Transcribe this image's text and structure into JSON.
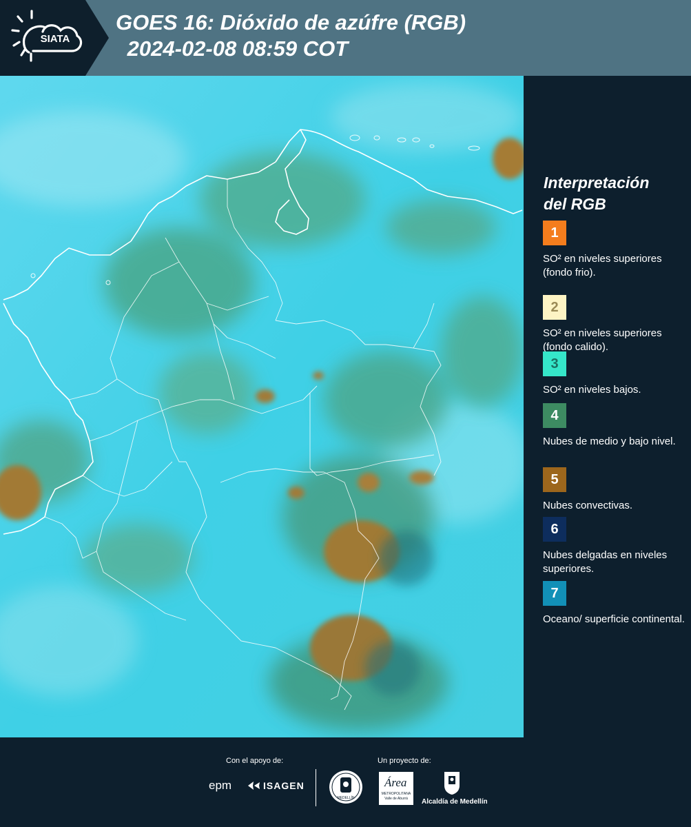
{
  "header": {
    "logo_text": "SIATA",
    "title_line1": "GOES 16: Dióxido de azúfre (RGB)",
    "title_line2": " 2024-02-08 08:59 COT"
  },
  "map": {
    "satellite": "GOES 16",
    "product": "Dióxido de azúfre (RGB)"
  },
  "legend": {
    "title_line1": "Interpretación",
    "title_line2": "del RGB",
    "items": [
      {
        "number": "1",
        "color": "#f47d1d",
        "text_color": "#ffffff",
        "label": "SO² en niveles superiores (fondo frio)."
      },
      {
        "number": "2",
        "color": "#fdf4c4",
        "text_color": "#9a8a55",
        "label": "SO² en niveles superiores (fondo calido)."
      },
      {
        "number": "3",
        "color": "#35e6c9",
        "text_color": "#1a6f62",
        "label": "SO² en niveles bajos."
      },
      {
        "number": "4",
        "color": "#3d8b62",
        "text_color": "#ffffff",
        "label": "Nubes de medio y bajo nivel."
      },
      {
        "number": "5",
        "color": "#9c661c",
        "text_color": "#ffffff",
        "label": "Nubes convectivas."
      },
      {
        "number": "6",
        "color": "#0d2d5d",
        "text_color": "#ffffff",
        "label": "Nubes delgadas en niveles superiores."
      },
      {
        "number": "7",
        "color": "#1290b7",
        "text_color": "#ffffff",
        "label": "Oceano/ superficie continental."
      }
    ]
  },
  "footer": {
    "support_caption": "Con el apoyo de:",
    "project_caption": "Un proyecto de:",
    "sponsors": [
      "epm",
      "ISAGEN"
    ],
    "partners": [
      "MEDELLÍN",
      "Área METROPOLITANA Valle de Aburrá",
      "Alcaldía de Medellín"
    ],
    "area_logo": "Área",
    "area_sub1": "METROPOLITANA",
    "area_sub2": "Valle de Aburrá",
    "alcaldia_label": "Alcaldía de Medellín",
    "seal_text": "MEDELLÍN"
  }
}
